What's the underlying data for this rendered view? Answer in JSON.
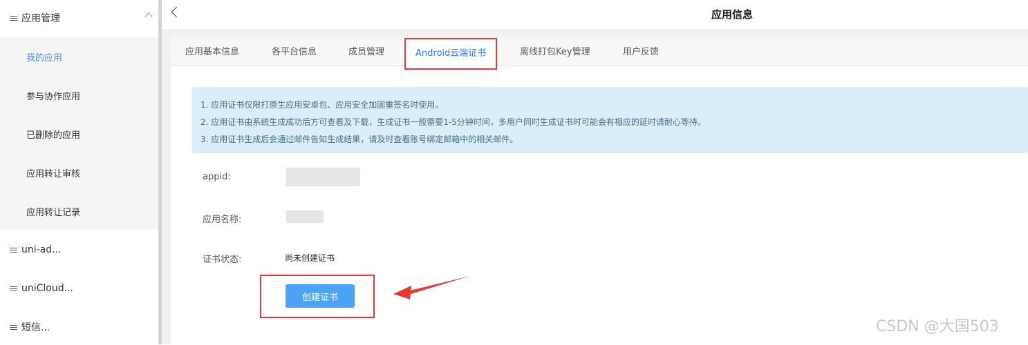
{
  "sidebar": {
    "groups": [
      {
        "label": "应用管理",
        "expanded": true
      },
      {
        "label": "uni-ad..."
      },
      {
        "label": "uniCloud..."
      },
      {
        "label": "短信..."
      }
    ],
    "submenu": [
      {
        "label": "我的应用",
        "active": true
      },
      {
        "label": "参与协作应用"
      },
      {
        "label": "已删除的应用"
      },
      {
        "label": "应用转让审核"
      },
      {
        "label": "应用转让记录"
      }
    ]
  },
  "header": {
    "title": "应用信息"
  },
  "tabs": [
    {
      "label": "应用基本信息"
    },
    {
      "label": "各平台信息"
    },
    {
      "label": "成员管理"
    },
    {
      "label": "Android云端证书",
      "active": true
    },
    {
      "label": "离线打包Key管理"
    },
    {
      "label": "用户反馈"
    }
  ],
  "notice": {
    "lines": [
      "1. 应用证书仅限打原生应用安卓包、应用安全加固重签名时使用。",
      "2. 应用证书由系统生成成功后方可查看及下载，生成证书一般需要1-5分钟时间，多用户同时生成证书时可能会有相应的延时请耐心等待。",
      "3. 应用证书生成后会通过邮件告知生成结果，请及时查看账号绑定邮箱中的相关邮件。"
    ]
  },
  "fields": {
    "appid_label": "appid:",
    "name_label": "应用名称:",
    "status_label": "证书状态:",
    "status_value": "尚未创建证书"
  },
  "actions": {
    "create_label": "创建证书"
  },
  "watermark": "CSDN @大国503",
  "colors": {
    "accent": "#4aa3f5",
    "highlight": "#e53935",
    "active_text": "#2b7de9"
  }
}
